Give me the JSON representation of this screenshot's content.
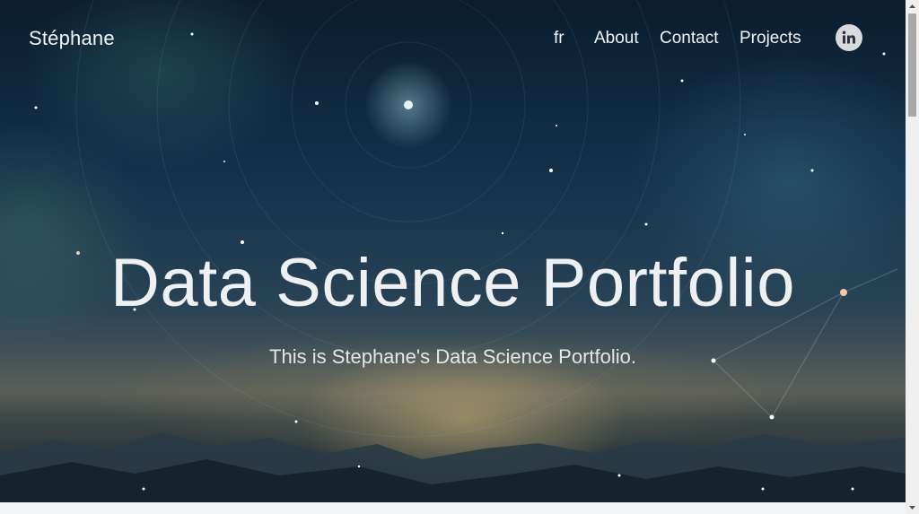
{
  "nav": {
    "brand": "Stéphane",
    "language": "fr",
    "links": [
      "About",
      "Contact",
      "Projects"
    ],
    "social_icon": "linkedin-icon"
  },
  "hero": {
    "title": "Data Science Portfolio",
    "subtitle": "This is Stephane's Data Science Portfolio."
  },
  "colors": {
    "text": "#eef0f2",
    "sky_dark": "#0b1d2f",
    "glow": "#cdb478",
    "scrollbar_track": "#f0f0f0",
    "scrollbar_thumb": "#a8a8a8"
  }
}
